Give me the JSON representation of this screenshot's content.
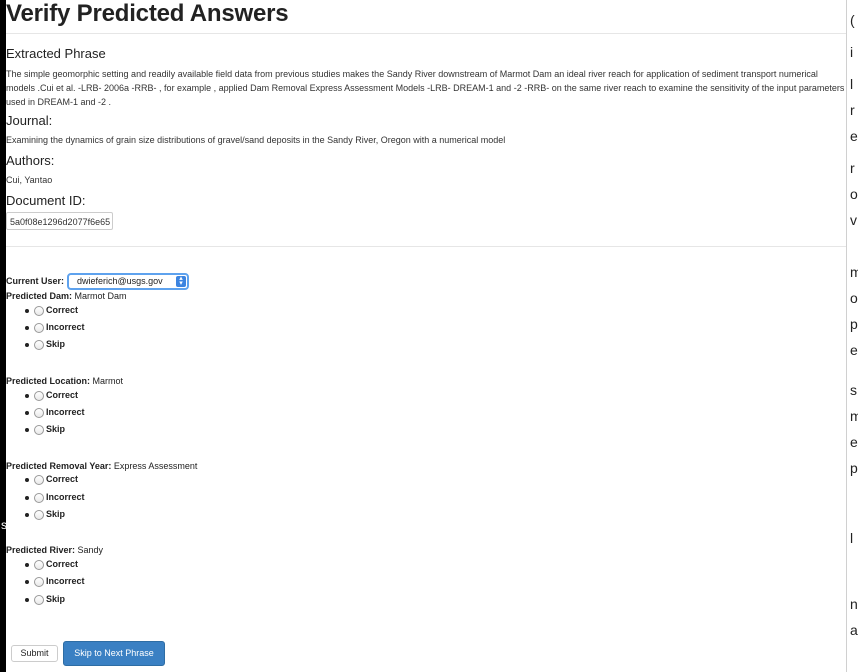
{
  "page": {
    "title": "Verify Predicted Answers"
  },
  "phrase": {
    "heading": "Extracted Phrase",
    "text": "The simple geomorphic setting and readily available field data from previous studies makes the Sandy River downstream of Marmot Dam an ideal river reach for application of sediment transport numerical models .Cui et al. -LRB- 2006a -RRB- , for example , applied Dam Removal Express Assessment Models -LRB- DREAM-1 and -2 -RRB- on the same river reach to examine the sensitivity of the input parameters used in DREAM-1 and -2 ."
  },
  "journal": {
    "heading": "Journal:",
    "text": "Examining the dynamics of grain size distributions of gravel/sand deposits in the Sandy River, Oregon with a numerical model"
  },
  "authors": {
    "heading": "Authors:",
    "text": "Cui, Yantao"
  },
  "document": {
    "heading": "Document ID:",
    "value": "5a0f08e1296d2077f6e65"
  },
  "user": {
    "label": "Current User:",
    "selected": "dwieferich@usgs.gov"
  },
  "predictions": [
    {
      "label": "Predicted Dam:",
      "value": " Marmot Dam"
    },
    {
      "label": "Predicted Location:",
      "value": " Marmot"
    },
    {
      "label": "Predicted Removal Year:",
      "value": " Express Assessment"
    },
    {
      "label": "Predicted River:",
      "value": " Sandy"
    }
  ],
  "options": {
    "correct": "Correct",
    "incorrect": "Incorrect",
    "skip": "Skip"
  },
  "buttons": {
    "submit": "Submit",
    "skip_next": "Skip to Next Phrase"
  },
  "edge_chars": [
    "(",
    "i",
    "l",
    "r",
    "e",
    "r",
    "o",
    "v",
    "m",
    "o",
    "p",
    "e",
    "s",
    "m",
    "e",
    "p",
    "l",
    "n",
    "a"
  ]
}
